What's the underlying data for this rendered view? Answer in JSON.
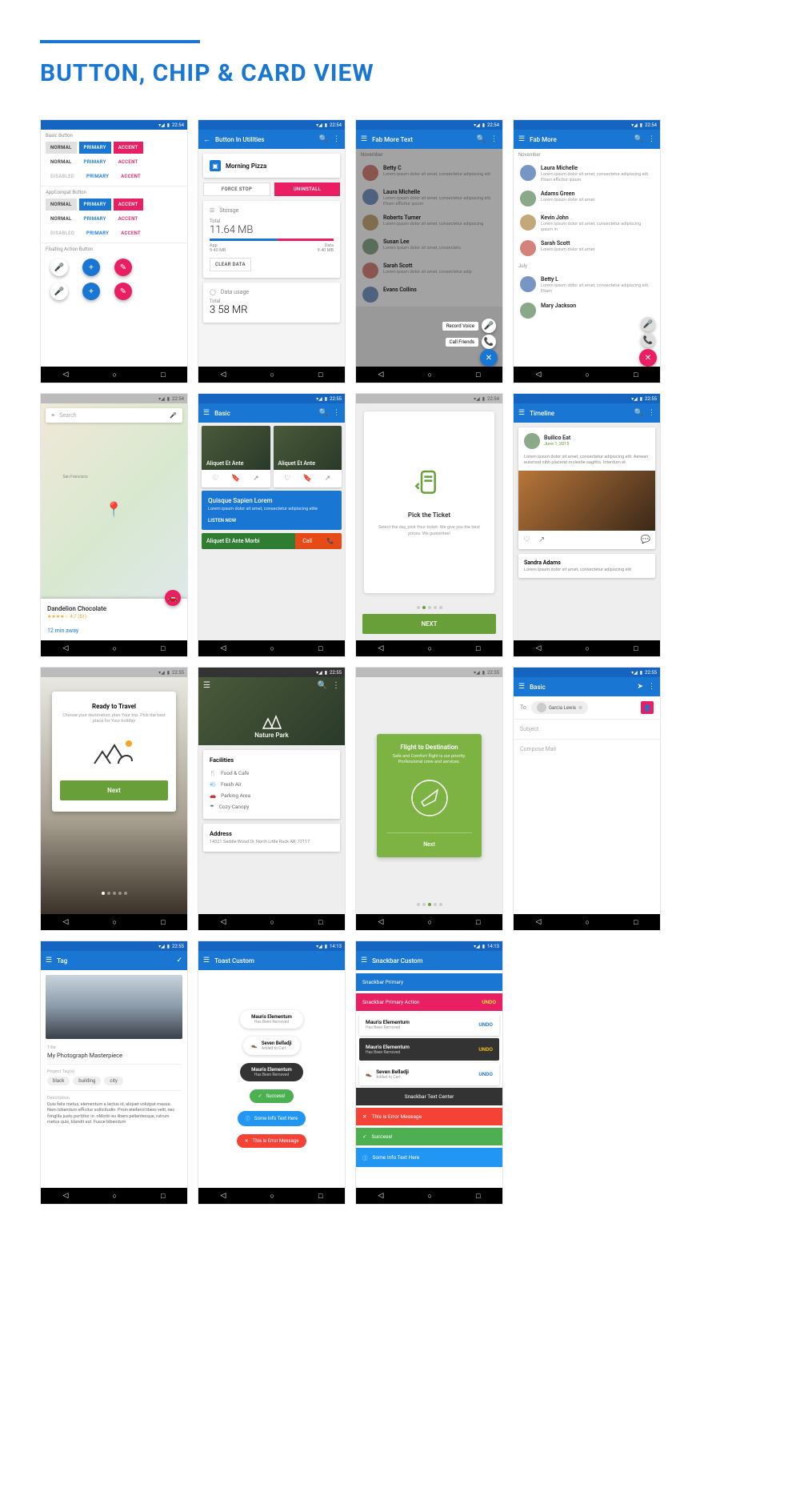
{
  "page": {
    "title": "BUTTON, CHIP & CARD VIEW"
  },
  "time": "22:54",
  "time2": "22:55",
  "time3": "14:13",
  "s1": {
    "basic": "Basic Button",
    "appcompat": "AppCompat Button",
    "floating": "Floating Action Button",
    "normal": "NORMAL",
    "primary": "PRIMARY",
    "accent": "ACCENT",
    "disabled": "DISABLED"
  },
  "s2": {
    "title": "Button In Utilities",
    "app": "Morning Pizza",
    "force": "FORCE STOP",
    "uninstall": "UNINSTALL",
    "storage": "Storage",
    "total": "Total",
    "totalv": "11.64 MB",
    "appl": "App",
    "appv": "9.40 MB",
    "datal": "Data",
    "datav": "9.40 MB",
    "clear": "CLEAR DATA",
    "usage": "Data usage",
    "total2": "Total",
    "total2v": "3 58 MR"
  },
  "s3": {
    "title": "Fab More Text",
    "month": "November",
    "people": [
      {
        "n": "Betty C",
        "s": "Lorem ipsum dolor sit amet, consectetur adipiscing elit"
      },
      {
        "n": "Laura Michelle",
        "s": "Lorem ipsum dolor sit amet, consectetur adipiscing elit. Etiam efficitur ipsum"
      },
      {
        "n": "Roberts Turner",
        "s": "Lorem ipsum dolor sit amet, consectetur adipiscing"
      },
      {
        "n": "Susan Lee",
        "s": "Lorem ipsum dolor sit amet, consectetu"
      },
      {
        "n": "Sarah Scott",
        "s": "Lorem ipsum dolor sit amet, consectetur adip"
      },
      {
        "n": "Evans Collins",
        "s": ""
      }
    ],
    "fab1": "Record Voice",
    "fab2": "Call Friends"
  },
  "s4": {
    "title": "Fab More",
    "month": "November",
    "month2": "July",
    "people": [
      {
        "n": "Laura Michelle",
        "s": "Lorem ipsum dolor sit amet, consectetur adipiscing elit. Etiam efficitur ipsum"
      },
      {
        "n": "Adams Green",
        "s": "Lorem ipsum dolor sit amet"
      },
      {
        "n": "Kevin John",
        "s": "Lorem ipsum dolor sit amet, consectetur adipiscing ipsum in"
      },
      {
        "n": "Sarah Scott",
        "s": "Lorem ipsum dolor sit amet"
      }
    ],
    "people2": [
      {
        "n": "Betty L",
        "s": "Lorem ipsum dolor sit amet, consectetur adipiscing elit. Etiam"
      },
      {
        "n": "Mary Jackson",
        "s": ""
      }
    ]
  },
  "s5": {
    "search": "Search",
    "place": "Dandelion Chocolate",
    "rating": "★★★★☆ 4.7 (51)",
    "away": "12 min away"
  },
  "s6": {
    "title": "Basic",
    "card": "Aliquet Et Ante",
    "hcard": "Quisque Sapien Lorem",
    "hdesc": "Lorem ipsum dolor sit amet, consectetur adipiscing elite",
    "listen": "LISTEN NOW",
    "gcard": "Aliquet Et Ante Morbi",
    "call": "Call"
  },
  "s7": {
    "title": "Pick the Ticket",
    "desc": "Select the day, pick Your ticket. We give you the best prices. We guarantee!",
    "next": "NEXT"
  },
  "s8": {
    "title": "Timeline",
    "author": "Builico Eat",
    "date": "June 1, 2015",
    "desc": "Lorem ipsum dolor sit amet, consectetur adipiscing elit. Aenean euismod nibh placerat molestie sagittis. Interdum et",
    "author2": "Sandra Adams",
    "desc2": "Lorem ipsum dolor sit amet, consectetur adipiscing elit"
  },
  "s9": {
    "title": "Ready to Travel",
    "desc": "Choose your destination, plan Your trip. Pick the best place for Your holiday",
    "next": "Next"
  },
  "s10": {
    "place": "Nature Park",
    "fac": "Facilities",
    "items": [
      "Food & Cafe",
      "Fresh Air",
      "Parking Area",
      "Cozy Canopy"
    ],
    "addr": "Address",
    "addrv": "14321 Saddle Wood Dr, North Little Rock AR, 72117"
  },
  "s11": {
    "title": "Flight to Destination",
    "desc": "Safe and Comfort flight is our priority. Professional crew and services.",
    "next": "Next"
  },
  "s12": {
    "title": "Basic",
    "to": "To",
    "name": "Garcia Lewis",
    "subject": "Subject",
    "compose": "Compose Mail"
  },
  "s13": {
    "title": "Tag",
    "tlabel": "Title",
    "tval": "My Photograph Masterpiece",
    "tags_label": "Project Tag(s)",
    "tags": [
      "black",
      "building",
      "city"
    ],
    "dlabel": "Description",
    "dval": "Duis felis metus, elementum a lectus id, aliquet volutpat massa. Nam bibendum efficitur sollicitudin. Proin eleifend libero velit, nec fringilla justo porttitor in. nMorbi eu libero pellentesque, rutrum metus quis, blandit est. Fusce bibendum"
  },
  "s14": {
    "title": "Toast Custom",
    "t1": "Mauris Elementum",
    "t1s": "Has Been Removed",
    "t2": "Seven Belladji",
    "t2s": "Added to Cart",
    "t3": "Mauris Elementum",
    "t3s": "Has Been Removed",
    "t4": "Success!",
    "t5": "Some Info Text Here",
    "t6": "This is Error Message"
  },
  "s15": {
    "title": "Snackbar Custom",
    "s1": "Snackbar Primary",
    "s2": "Snackbar Primary Action",
    "undo": "UNDO",
    "s3": "Mauris Elementum",
    "s3s": "Has Been Removed",
    "s4": "Mauris Elementum",
    "s4s": "Has Been Removed",
    "s5": "Seven Belladji",
    "s5s": "Added to Cart",
    "s6": "Snackbar Text Center",
    "s7": "This is Error Message",
    "s8": "Success!",
    "s9": "Some Info Text Here"
  }
}
